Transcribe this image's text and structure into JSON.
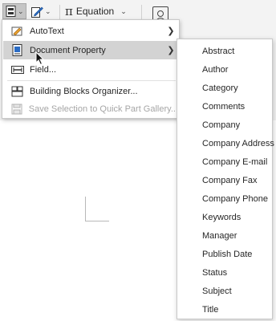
{
  "ribbon": {
    "equation_label": "Equation"
  },
  "menu": {
    "items": [
      {
        "label": "AutoText",
        "icon": "autotext-icon",
        "has_submenu": true,
        "enabled": true
      },
      {
        "label": "Document Property",
        "icon": "document-property-icon",
        "has_submenu": true,
        "enabled": true,
        "highlighted": true
      },
      {
        "label": "Field...",
        "icon": "field-icon",
        "has_submenu": false,
        "enabled": true
      },
      {
        "label": "Building Blocks Organizer...",
        "icon": "building-blocks-icon",
        "has_submenu": false,
        "enabled": true
      },
      {
        "label": "Save Selection to Quick Part Gallery...",
        "icon": "save-icon",
        "has_submenu": false,
        "enabled": false
      }
    ]
  },
  "submenu": {
    "items": [
      "Abstract",
      "Author",
      "Category",
      "Comments",
      "Company",
      "Company Address",
      "Company E-mail",
      "Company Fax",
      "Company Phone",
      "Keywords",
      "Manager",
      "Publish Date",
      "Status",
      "Subject",
      "Title"
    ]
  },
  "colors": {
    "highlight": "#d3d3d3",
    "disabled_text": "#a6a6a6",
    "ribbon_bg": "#f3f3f3"
  }
}
